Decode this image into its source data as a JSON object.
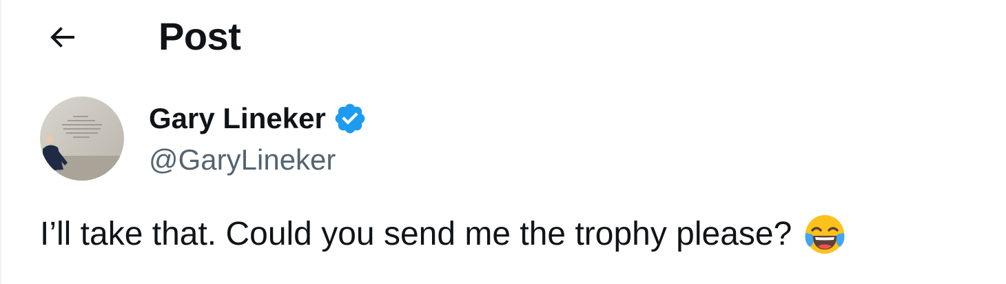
{
  "header": {
    "back_icon": "arrow-left-icon",
    "title": "Post"
  },
  "post": {
    "author": {
      "display_name": "Gary Lineker",
      "handle": "@GaryLineker",
      "verified": true,
      "verified_icon": "verified-badge-icon",
      "verified_color": "#1d9bf0"
    },
    "text": "I’ll take that. Could you send me the trophy please?",
    "emoji_icon": "face-with-tears-of-joy-emoji"
  },
  "colors": {
    "text_primary": "#0f1419",
    "text_secondary": "#536471",
    "accent": "#1d9bf0",
    "background": "#ffffff"
  }
}
